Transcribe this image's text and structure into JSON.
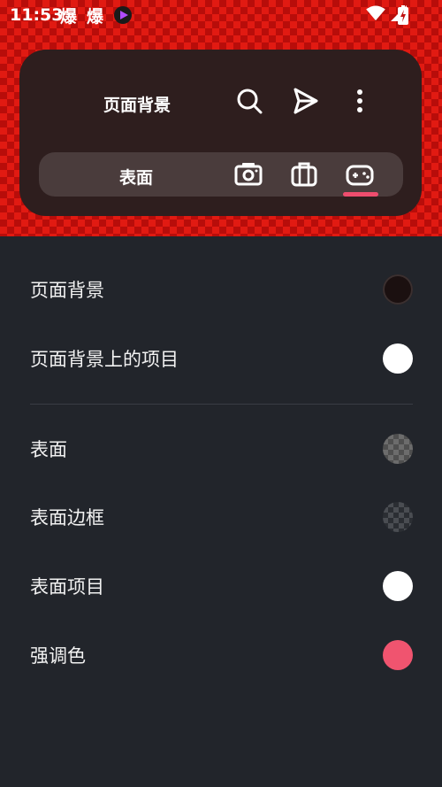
{
  "status_bar": {
    "time": "11:53",
    "app_icon_1": "爆",
    "app_icon_2": "爆",
    "app_icon_3": "play-video-icon",
    "wifi": "wifi-icon",
    "signal": "signal-icon",
    "battery": "battery-charging-icon"
  },
  "toolbar": {
    "title": "页面背景",
    "search_icon": "search-icon",
    "send_icon": "send-icon",
    "menu_icon": "more-vert-icon"
  },
  "tabs": {
    "current_label": "表面",
    "items": [
      {
        "icon": "camera-icon"
      },
      {
        "icon": "briefcase-icon"
      },
      {
        "icon": "gamepad-icon",
        "selected": true
      }
    ]
  },
  "colors": {
    "accent": "#f0546f",
    "list_background": "#22252b",
    "card_background": "#2e1e1e"
  },
  "list": [
    {
      "label": "页面背景",
      "swatch": "#1b1010"
    },
    {
      "label": "页面背景上的项目",
      "swatch": "#ffffff"
    },
    {
      "label": "表面",
      "swatch": "checker-gray"
    },
    {
      "label": "表面边框",
      "swatch": "checker-dark"
    },
    {
      "label": "表面项目",
      "swatch": "#ffffff"
    },
    {
      "label": "强调色",
      "swatch": "#f0546f"
    }
  ]
}
